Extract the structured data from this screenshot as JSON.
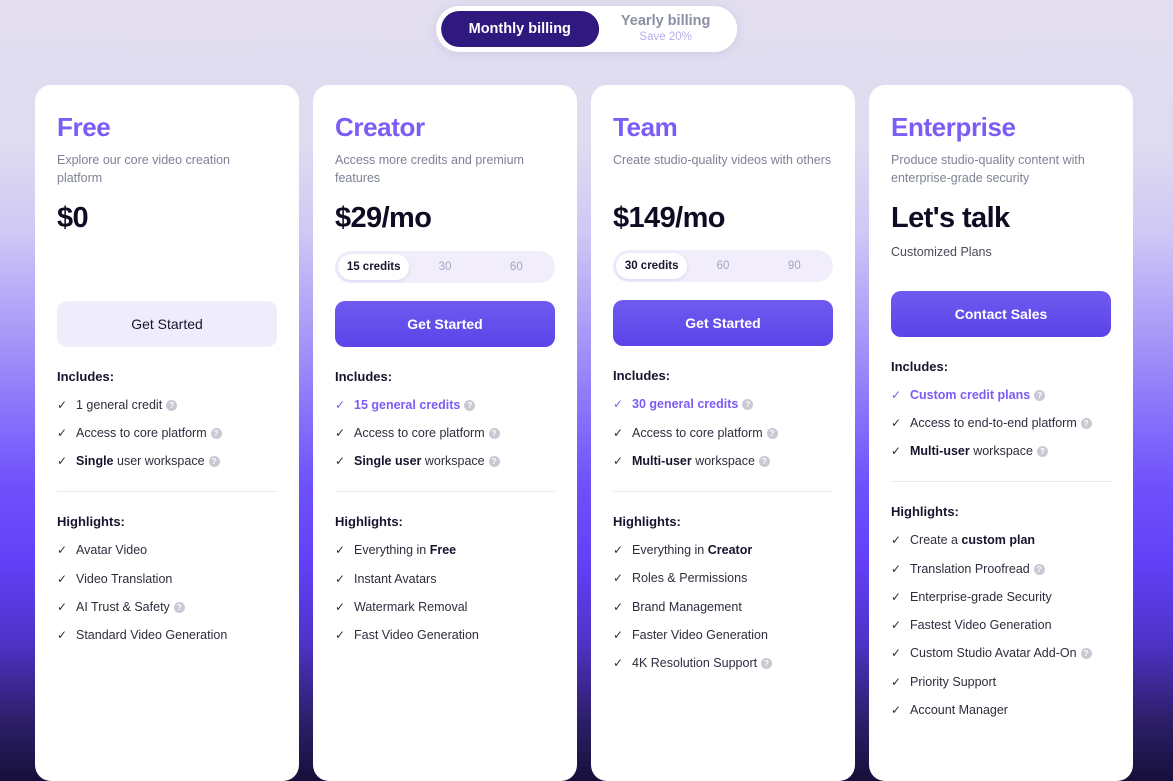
{
  "billing_toggle": {
    "monthly": {
      "label": "Monthly billing",
      "active": true
    },
    "yearly": {
      "label": "Yearly billing",
      "sublabel": "Save 20%",
      "active": false
    }
  },
  "accent_color": "#7b5cf5",
  "sections": {
    "includes_title": "Includes:",
    "highlights_title": "Highlights:"
  },
  "plans": [
    {
      "name": "Free",
      "description": "Explore our core video creation platform",
      "price": "$0",
      "price_sub": "",
      "cta": {
        "label": "Get Started",
        "style": "ghost"
      },
      "credits": null,
      "includes": [
        {
          "text": "1 general credit",
          "info": true,
          "accent": false
        },
        {
          "text": "Access to core platform",
          "info": true,
          "accent": false
        },
        {
          "bold": "Single",
          "text": " user workspace",
          "info": true,
          "accent": false
        }
      ],
      "highlights": [
        {
          "text": "Avatar Video",
          "info": false
        },
        {
          "text": "Video Translation",
          "info": false
        },
        {
          "text": "AI Trust & Safety",
          "info": true
        },
        {
          "text": "Standard Video Generation",
          "info": false
        }
      ]
    },
    {
      "name": "Creator",
      "description": "Access more credits and premium features",
      "price": "$29/mo",
      "price_sub": "",
      "cta": {
        "label": "Get Started",
        "style": "primary"
      },
      "credits": {
        "options": [
          "15 credits",
          "30",
          "60"
        ],
        "selected": 0
      },
      "includes": [
        {
          "text": "15 general credits",
          "info": true,
          "accent": true
        },
        {
          "text": "Access to core platform",
          "info": true,
          "accent": false
        },
        {
          "bold": "Single user",
          "text": " workspace",
          "info": true,
          "accent": false
        }
      ],
      "highlights": [
        {
          "text": "Everything in ",
          "bold_after": "Free",
          "info": false
        },
        {
          "text": "Instant Avatars",
          "info": false
        },
        {
          "text": "Watermark Removal",
          "info": false
        },
        {
          "text": "Fast Video Generation",
          "info": false
        }
      ]
    },
    {
      "name": "Team",
      "description": "Create studio-quality videos with others",
      "price": "$149/mo",
      "price_sub": "",
      "cta": {
        "label": "Get Started",
        "style": "primary"
      },
      "credits": {
        "options": [
          "30 credits",
          "60",
          "90"
        ],
        "selected": 0
      },
      "includes": [
        {
          "text": "30 general credits",
          "info": true,
          "accent": true
        },
        {
          "text": "Access to core platform",
          "info": true,
          "accent": false
        },
        {
          "bold": "Multi-user",
          "text": " workspace",
          "info": true,
          "accent": false
        }
      ],
      "highlights": [
        {
          "text": "Everything in ",
          "bold_after": "Creator",
          "info": false
        },
        {
          "text": "Roles & Permissions",
          "info": false
        },
        {
          "text": "Brand Management",
          "info": false
        },
        {
          "text": "Faster Video Generation",
          "info": false
        },
        {
          "text": "4K Resolution Support",
          "info": true
        }
      ]
    },
    {
      "name": "Enterprise",
      "description": "Produce studio-quality content with enterprise-grade security",
      "price": "Let's talk",
      "price_sub": "Customized Plans",
      "cta": {
        "label": "Contact Sales",
        "style": "primary"
      },
      "credits": null,
      "includes": [
        {
          "text": "Custom credit plans",
          "info": true,
          "accent": true
        },
        {
          "text": "Access to end-to-end platform",
          "info": true,
          "accent": false
        },
        {
          "bold": "Multi-user",
          "text": " workspace",
          "info": true,
          "accent": false
        }
      ],
      "highlights": [
        {
          "text": "Create a ",
          "bold_after": "custom plan",
          "info": false
        },
        {
          "text": "Translation Proofread",
          "info": true
        },
        {
          "text": "Enterprise-grade Security",
          "info": false
        },
        {
          "text": "Fastest Video Generation",
          "info": false
        },
        {
          "text": "Custom Studio Avatar Add-On",
          "info": true
        },
        {
          "text": "Priority Support",
          "info": false
        },
        {
          "text": "Account Manager",
          "info": false
        }
      ]
    }
  ]
}
